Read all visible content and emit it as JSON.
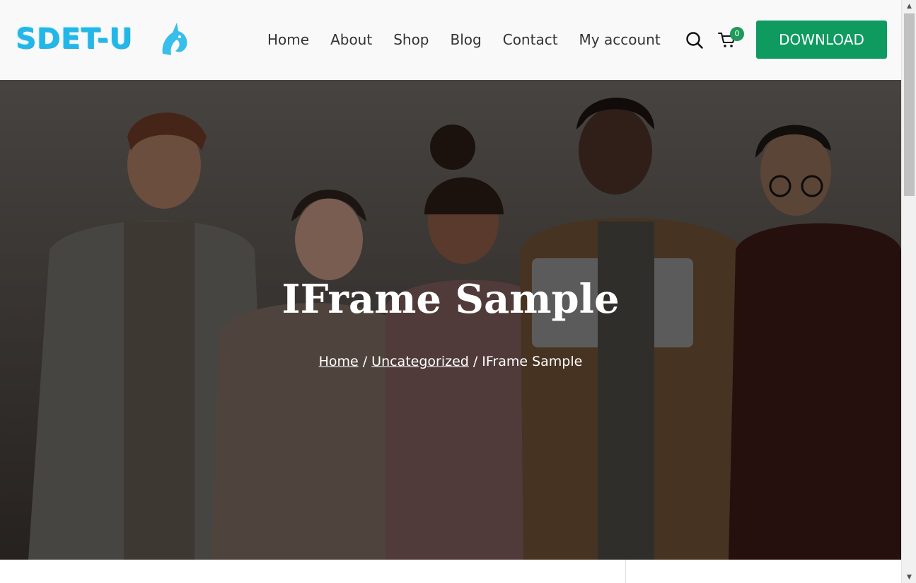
{
  "header": {
    "logo_text": "SDET-U",
    "nav": [
      "Home",
      "About",
      "Shop",
      "Blog",
      "Contact",
      "My account"
    ],
    "cart_count": "0",
    "download_label": "DOWNLOAD"
  },
  "hero": {
    "title": "IFrame Sample",
    "breadcrumb": {
      "home": "Home",
      "sep1": "/",
      "category": "Uncategorized",
      "sep2": "/",
      "current": "IFrame Sample"
    }
  },
  "colors": {
    "accent": "#0f9a5f",
    "logo": "#22b7e8",
    "nav_text": "#333333",
    "header_bg": "#f9f9f9"
  },
  "icons": {
    "search": "search-icon",
    "cart": "cart-icon",
    "scroll_up": "scroll-up-arrow",
    "scroll_down": "scroll-down-arrow"
  }
}
